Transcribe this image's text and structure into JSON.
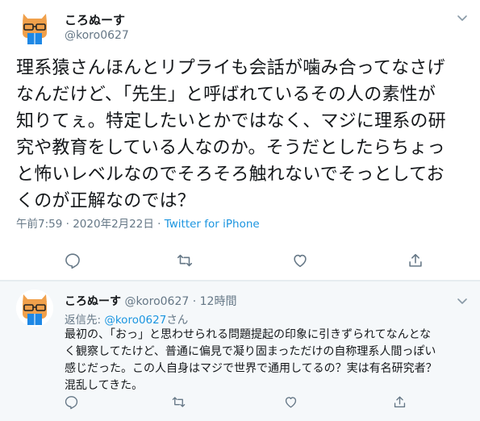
{
  "main_tweet": {
    "display_name": "ころぬーす",
    "handle": "@koro0627",
    "text": "理系猿さんほんとリプライも会話が噛み合ってなさげ\nなんだけど、「先生」と呼ばれているその人の素性が\n知りてぇ。特定したいとかではなく、マジに理系の研\n究や教育をしている人なのか。そうだとしたらちょっ\nと怖いレベルなのでそろそろ触れないでそっとしてお\nくのが正解なのでは？",
    "time": "午前7:59",
    "separator": "·",
    "date": "2020年2月22日",
    "separator2": "·",
    "source": "Twitter for iPhone"
  },
  "reply_tweet": {
    "display_name": "ころぬーす",
    "handle": "@koro0627",
    "dot": "·",
    "time_ago": "12時間",
    "reply_prefix": "返信先: ",
    "reply_mention": "@koro0627",
    "reply_suffix": "さん",
    "text": "最初の、「おっ」と思わせられる問題提起の印象に引きずられてなんとな\nく観察してたけど、普通に偏見で凝り固まっただけの自称理系人間っぽい\n感じだった。この人自身はマジで世界で通用してるの？実は有名研究者？\n混乱してきた。"
  },
  "icons": {
    "reply": "reply-icon",
    "retweet": "retweet-icon",
    "like": "heart-icon",
    "share": "share-icon",
    "menu": "chevron-down-icon"
  },
  "colors": {
    "text": "#14171a",
    "muted": "#657786",
    "link": "#1b95e0",
    "avatar_orange": "#f0a04b",
    "avatar_blue": "#1e88e5",
    "reply_bg": "#f5f8fa"
  }
}
